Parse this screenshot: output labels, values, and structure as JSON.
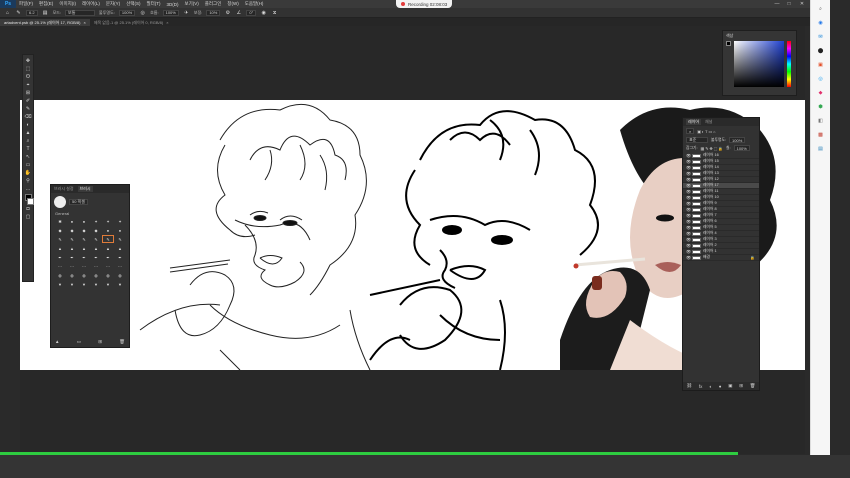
{
  "app": {
    "logo": "Ps"
  },
  "menu": [
    "파일(F)",
    "편집(E)",
    "이미지(I)",
    "레이어(L)",
    "문자(Y)",
    "선택(S)",
    "필터(T)",
    "3D(D)",
    "보기(V)",
    "플러그인",
    "창(W)",
    "도움말(H)"
  ],
  "recording": {
    "label": "Recording 02:08:03"
  },
  "window_controls": {
    "minimize": "—",
    "maximize": "□",
    "close": "✕"
  },
  "options": {
    "size": "6.2",
    "mode_label": "모드:",
    "mode_value": "보통",
    "opacity_label": "불투명도:",
    "opacity_value": "100%",
    "flow_label": "흐름:",
    "flow_value": "100%",
    "smoothing_label": "보정:",
    "smoothing_value": "10%",
    "angle_value": "0°"
  },
  "tabs": [
    {
      "label": "artadvent.psb @ 25.1% (레이어 17, RGB/8)",
      "close": "×"
    },
    {
      "label": "제목 없음-1 @ 25.1% (레이어 0, RGB/8)",
      "close": "×"
    }
  ],
  "tools": [
    "✥",
    "⬚",
    "ʘ",
    "⌖",
    "⊞",
    "✐",
    "✎",
    "⌫",
    "◐",
    "▲",
    "⌕",
    "T",
    "↖",
    "▭",
    "✋",
    "⚲",
    "…"
  ],
  "brush_panel": {
    "tabs": [
      "브러시 설정",
      "브러시"
    ],
    "size_value": "50 픽셀",
    "group": "General",
    "brushes": [
      "✱",
      "●",
      "●",
      "✦",
      "✦",
      "✦",
      "◆",
      "◆",
      "◆",
      "◆",
      "●",
      "●",
      "✎",
      "✎",
      "✎",
      "✎",
      "✎",
      "✎",
      "▲",
      "▲",
      "▲",
      "▲",
      "▲",
      "▲",
      "✒",
      "✒",
      "✒",
      "✒",
      "✒",
      "✒",
      "⋯",
      "⋯",
      "⋯",
      "⋯",
      "⋯",
      "⋯",
      "◍",
      "◍",
      "◍",
      "◍",
      "◍",
      "◍",
      "▼",
      "▼",
      "▼",
      "▼",
      "▼",
      "▼"
    ]
  },
  "color_panel": {
    "title": "색상"
  },
  "layers_panel": {
    "tabs": [
      "레이어",
      "채널"
    ],
    "blend": "표준",
    "opacity_label": "불투명도:",
    "opacity_value": "100%",
    "fill_label": "칠:",
    "fill_value": "100%",
    "lock_label": "잠그기:",
    "layers": [
      "레이어 16",
      "레이어 15",
      "레이어 14",
      "레이어 13",
      "레이어 12",
      "레이어 17",
      "레이어 11",
      "레이어 10",
      "레이어 9",
      "레이어 8",
      "레이어 7",
      "레이어 6",
      "레이어 5",
      "레이어 4",
      "레이어 3",
      "레이어 2",
      "레이어 1",
      "배경"
    ],
    "selected_index": 5,
    "footer": [
      "⛓",
      "fx",
      "◐",
      "●",
      "▣",
      "⊞",
      "🗑"
    ]
  },
  "sidebar_icons": [
    "⌕",
    "◉",
    "✉",
    "⬤",
    "▣",
    "◎",
    "◆",
    "⬢",
    "◧",
    "▩",
    "▤"
  ]
}
